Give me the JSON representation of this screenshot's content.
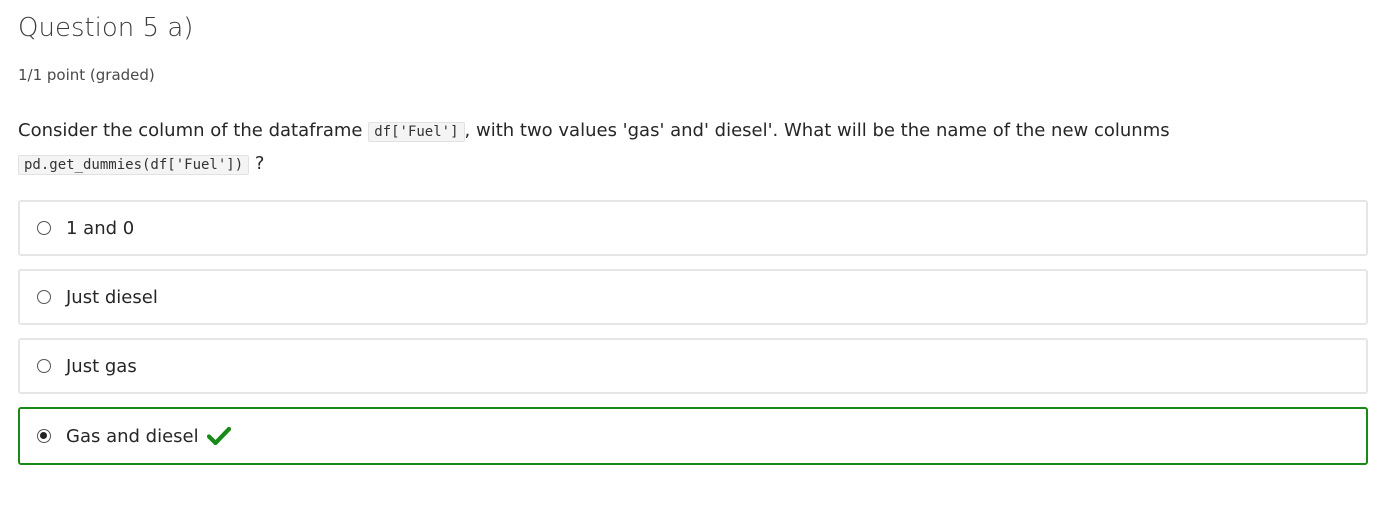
{
  "problem": {
    "title": "Question 5 a)",
    "points": "1/1 point (graded)",
    "prompt_part1": "Consider the column of the dataframe",
    "code1": "df['Fuel']",
    "prompt_part2": ", with two values 'gas' and' diesel'. What will be the name of the new colunms",
    "code2": "pd.get_dummies(df['Fuel'])",
    "prompt_part3": "?"
  },
  "choices": [
    {
      "label": "1 and 0",
      "selected": false
    },
    {
      "label": "Just diesel",
      "selected": false
    },
    {
      "label": "Just gas",
      "selected": false
    },
    {
      "label": "Gas and diesel",
      "selected": true,
      "status": "correct"
    }
  ],
  "colors": {
    "correct": "#178a17",
    "border": "#e6e6e6"
  },
  "icons": {
    "correct": "check-icon"
  }
}
